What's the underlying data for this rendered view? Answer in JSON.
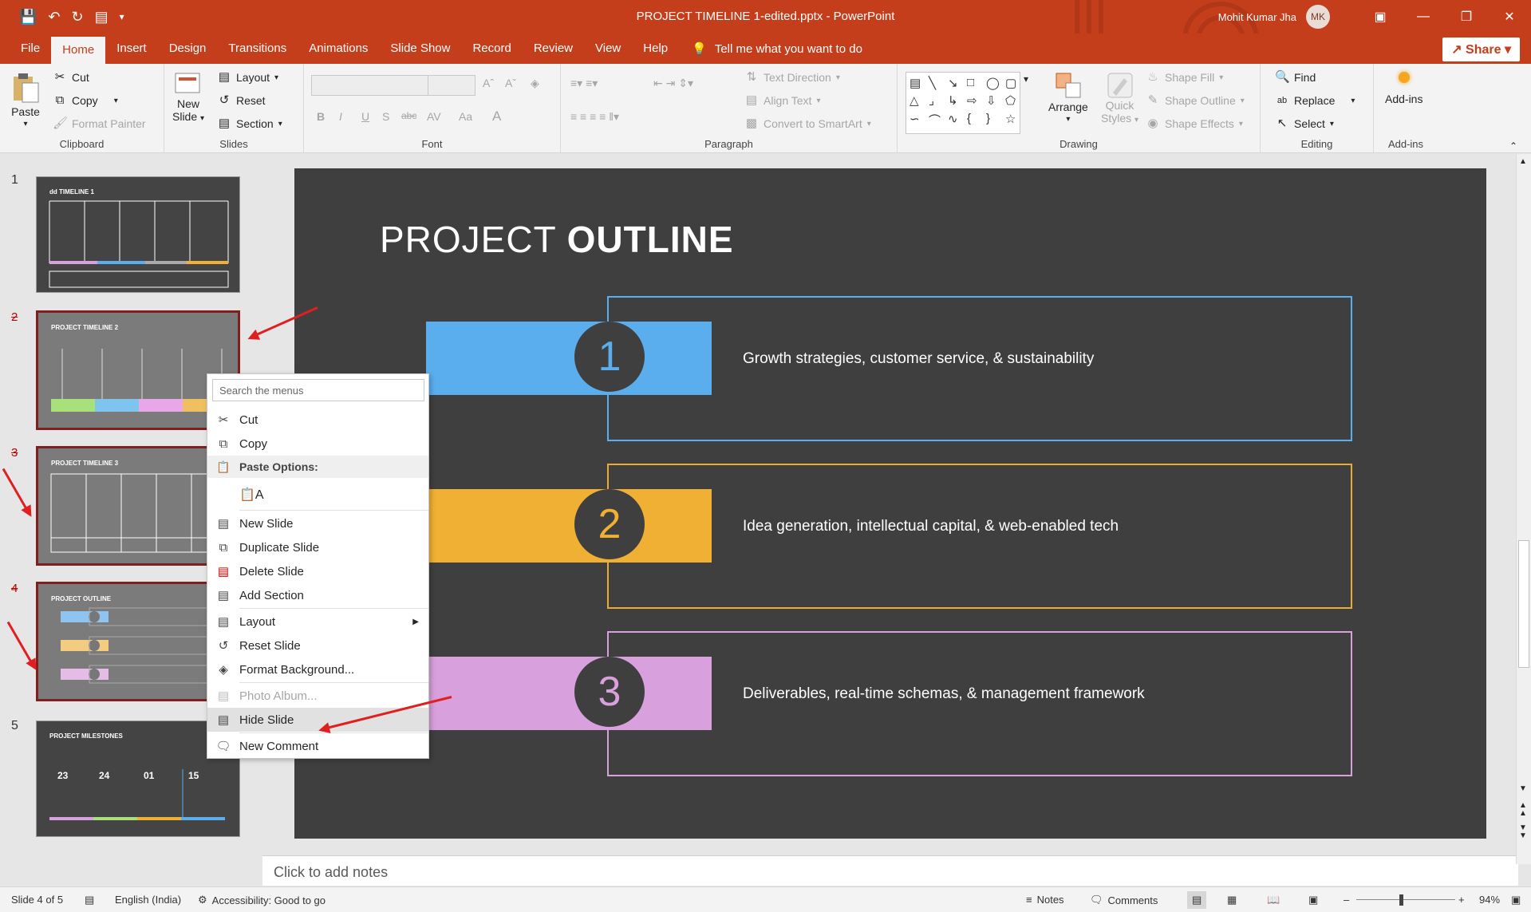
{
  "window": {
    "title": "PROJECT TIMELINE 1-edited.pptx  -  PowerPoint",
    "user_name": "Mohit Kumar Jha",
    "user_initials": "MK"
  },
  "menu": {
    "tabs": [
      "File",
      "Home",
      "Insert",
      "Design",
      "Transitions",
      "Animations",
      "Slide Show",
      "Record",
      "Review",
      "View",
      "Help"
    ],
    "tell_me": "Tell me what you want to do",
    "share": "Share"
  },
  "ribbon": {
    "clipboard": {
      "label": "Clipboard",
      "paste": "Paste",
      "cut": "Cut",
      "copy": "Copy",
      "format_painter": "Format Painter"
    },
    "slides": {
      "label": "Slides",
      "new_slide": "New",
      "new_slide2": "Slide",
      "layout": "Layout",
      "reset": "Reset",
      "section": "Section"
    },
    "font": {
      "label": "Font",
      "bold": "B",
      "italic": "I",
      "underline": "U",
      "shadow": "S",
      "strike": "abc",
      "spacing": "AV",
      "case": "Aa",
      "color": "A"
    },
    "paragraph": {
      "label": "Paragraph",
      "text_direction": "Text Direction",
      "align_text": "Align Text",
      "convert": "Convert to SmartArt"
    },
    "drawing": {
      "label": "Drawing",
      "arrange": "Arrange",
      "quick_styles": "Quick",
      "quick_styles2": "Styles",
      "shape_fill": "Shape Fill",
      "shape_outline": "Shape Outline",
      "shape_effects": "Shape Effects"
    },
    "editing": {
      "label": "Editing",
      "find": "Find",
      "replace": "Replace",
      "select": "Select"
    },
    "addins": {
      "label": "Add-ins",
      "button": "Add-ins"
    }
  },
  "thumbnails": [
    {
      "num": "1",
      "title": "dd TIMELINE 1",
      "hidden": false
    },
    {
      "num": "2",
      "title": "PROJECT TIMELINE 2",
      "hidden": true
    },
    {
      "num": "3",
      "title": "PROJECT TIMELINE 3",
      "hidden": true
    },
    {
      "num": "4",
      "title": "PROJECT OUTLINE",
      "hidden": true
    },
    {
      "num": "5",
      "title": "PROJECT MILESTONES",
      "hidden": false
    }
  ],
  "slide": {
    "title_light": "PROJECT ",
    "title_bold": "OUTLINE",
    "rows": [
      {
        "num": "1",
        "text": "Growth strategies, customer service, & sustainability",
        "color": "#5aaeee",
        "frame": "#5aaeee"
      },
      {
        "num": "2",
        "text": "Idea generation, intellectual capital, & web-enabled tech",
        "color": "#f0b033",
        "frame": "#e8ad33"
      },
      {
        "num": "3",
        "text": "Deliverables, real-time schemas, & management framework",
        "color": "#d8a0dc",
        "frame": "#d8a0dc"
      }
    ]
  },
  "context_menu": {
    "search_placeholder": "Search the menus",
    "cut": "Cut",
    "copy": "Copy",
    "paste_options": "Paste Options:",
    "new_slide": "New Slide",
    "duplicate_slide": "Duplicate Slide",
    "delete_slide": "Delete Slide",
    "add_section": "Add Section",
    "layout": "Layout",
    "reset_slide": "Reset Slide",
    "format_background": "Format Background...",
    "photo_album": "Photo Album...",
    "hide_slide": "Hide Slide",
    "new_comment": "New Comment"
  },
  "notes": {
    "placeholder": "Click to add notes"
  },
  "status": {
    "slide_info": "Slide 4 of 5",
    "language": "English (India)",
    "accessibility": "Accessibility: Good to go",
    "notes": "Notes",
    "comments": "Comments",
    "zoom": "94%"
  }
}
